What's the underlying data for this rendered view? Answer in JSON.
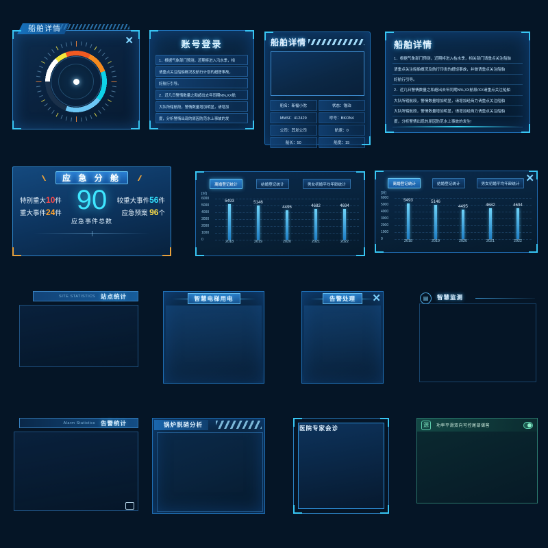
{
  "background_color": "#051526",
  "panels": {
    "ship_gauge": {
      "title": "船舶详情",
      "close_icon": "✕"
    },
    "account_login": {
      "title": "账号登录",
      "rows": [
        "1．根据气象部门预测，近期将进入汛水季，相",
        "请重点关注船舶概况及航行计划的超搭事故，",
        "好航行引导。",
        "2．近几日警情数量之和超出去年同期N%,XX航",
        "大队所辖航段，警情数量增加明显，请增加",
        "度，分析警情出现的原因防范水上事故的发"
      ]
    },
    "ship_detail": {
      "title": "船舶详情",
      "fields": [
        "船名：新福小驼",
        "状态：锚泊",
        "MMSI：412429",
        "呼号：BKON4",
        "公司：其发公司",
        "航速：0",
        "船长：50",
        "船宽：15"
      ]
    },
    "ship_notice": {
      "title": "船舶详情",
      "rows": [
        "1．根据气象部门预测，近期将进入枯水季，相关部门请重点关注船舶",
        "请重点关注船舶概况及航行印发的超短事故，并做请重点关注船舶",
        "好航行引导。",
        "2．近几日警情数量之和超出去年同期N%,XX航段/XX请重点关注船舶",
        "大队所辖航段，警情数量增加明显，请增加经商力请重点关注船舶",
        "大队所辖航段，警情数量增加明显，请增加经商力请重点关注船舶",
        "度，分析警情出现的原因防范水上事故的发生!"
      ]
    },
    "emergency": {
      "banner": "应 急 分 舱",
      "total_value": "90",
      "total_label": "应急事件总数",
      "left_stats": [
        {
          "label": "特别重大",
          "value": "10",
          "unit": "件",
          "color": "#ff4b4b"
        },
        {
          "label": "重大事件",
          "value": "24",
          "unit": "件",
          "color": "#ffa22e"
        }
      ],
      "right_stats": [
        {
          "label": "较重大事件",
          "value": "56",
          "unit": "件",
          "color": "#32e2ff"
        },
        {
          "label": "应急预案 ",
          "value": "96",
          "unit": "个",
          "color": "#ffe04a"
        }
      ]
    },
    "chart_left": {
      "close_icon": ""
    },
    "chart_right": {
      "close_icon": "✕"
    },
    "site_statistics": {
      "en": "SITE STATISTICS",
      "cn": "站点统计"
    },
    "smart_elevator": {
      "title": "智慧电梯用电"
    },
    "alarm_handling": {
      "title": "告警处理",
      "close_icon": "✕"
    },
    "smart_monitor": {
      "title": "智慧监测",
      "icon": "monitor-icon"
    },
    "alarm_statistics": {
      "en": "Alarm Statistics",
      "cn": "告警统计"
    },
    "boiler_analysis": {
      "title": "锅炉脱硝分析"
    },
    "hospital_consult": {
      "title": "医院专家会诊"
    },
    "green_panel": {
      "badge": "源",
      "text": "功率平滑双向可控尾部储窖"
    }
  },
  "chart_data": {
    "type": "bar",
    "title": "离婚登记统计",
    "tabs": [
      "离婚登记统计",
      "结婚登记统计",
      "男女初婚平均年龄统计"
    ],
    "active_tab": 0,
    "unit": "[对]",
    "categories": [
      "2018",
      "2019",
      "2020",
      "2021",
      "2022"
    ],
    "values": [
      5493,
      5146,
      4495,
      4682,
      4694
    ],
    "yticks": [
      "6000",
      "5000",
      "4000",
      "3000",
      "2000",
      "1000",
      "0"
    ],
    "ylim": [
      0,
      6000
    ],
    "xlabel": "",
    "ylabel": "[对]",
    "grid": true,
    "legend": "none"
  }
}
